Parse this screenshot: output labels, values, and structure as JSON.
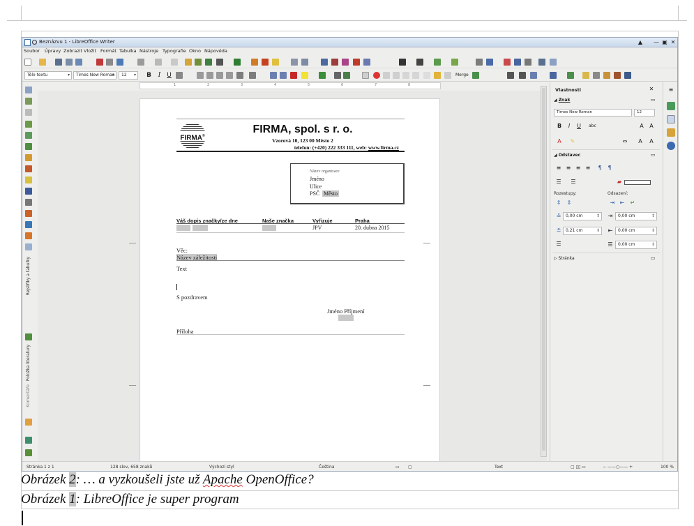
{
  "window": {
    "title": "Beznázvu 1 - LibreOffice Writer",
    "controls": [
      "▲",
      "—",
      "▣",
      "✕"
    ]
  },
  "menu": [
    "Soubor",
    "Úpravy",
    "Zobrazit",
    "Vložit",
    "Formát",
    "Tabulka",
    "Nástroje",
    "Typografie",
    "Okno",
    "Nápověda"
  ],
  "toolbar": {
    "paragraph_style": "Tělo textu",
    "font_name": "Times New Roman",
    "font_size": "12",
    "bold": "B",
    "italic": "I",
    "underline": "U",
    "merge_label": "Merge"
  },
  "left_panel": {
    "registers_label": "Rejstříky a tabulky",
    "bibliography_label": "Položka literatury",
    "comments_label": "Komentáře"
  },
  "letter": {
    "logo_text": "FIRMA",
    "logo_mark": "®",
    "company_name": "FIRMA, spol. s r. o.",
    "address": "Vzorová 10, 123 00 Město 2",
    "contact_prefix": "telefon: (+420) 222 333 111, web: ",
    "contact_web": "www.firma.cz",
    "recipient": {
      "org_placeholder": "Název organizace",
      "name": "Jméno",
      "street": "Ulice",
      "zip": "PSČ",
      "city": "Město"
    },
    "ref_headers": {
      "your_ref": "Váš dopis značky/ze dne",
      "our_ref": "Naše značka",
      "handled_by": "Vyřizuje",
      "place": "Praha"
    },
    "ref_values": {
      "handled_by": "JPV",
      "date": "20. dubna 2015"
    },
    "subject_label": "Věc:",
    "subject_value": "Název záležitosti",
    "body": "Text",
    "closing": "S pozdravem",
    "signature": "Jméno Příjmení",
    "attachment": "Příloha"
  },
  "sidebar": {
    "title": "Vlastnosti",
    "section_char": "Znak",
    "font_name": "Times New Roman",
    "font_size": "12",
    "section_paragraph": "Odstavec",
    "spacing_label": "Rozestupy:",
    "indent_label": "Odsazení:",
    "spin_above": "0,00 cm",
    "spin_below": "0,21 cm",
    "spin_indent_before": "0,00 cm",
    "spin_indent_after": "0,00 cm",
    "spin_first_line": "0,00 cm",
    "section_page": "Stránka"
  },
  "status": {
    "page": "Stránka 1 z 1",
    "words": "128 slov, 658 znaků",
    "page_style": "Výchozí styl",
    "language": "Čeština",
    "context": "Text",
    "zoom": "100 %"
  },
  "captions": {
    "figure_word": "Obrázek",
    "num2": "2",
    "cap2_a": ": … a vyzkoušeli jste už ",
    "cap2_apache": "Apache",
    "cap2_b": " OpenOffice?",
    "num1": "1",
    "cap1_text": ": LibreOffice je super program"
  },
  "colors": {
    "titlebar": "#c9d8ea",
    "field_shading": "#c8c8c8",
    "sidebar_bg": "#eeeeec"
  }
}
